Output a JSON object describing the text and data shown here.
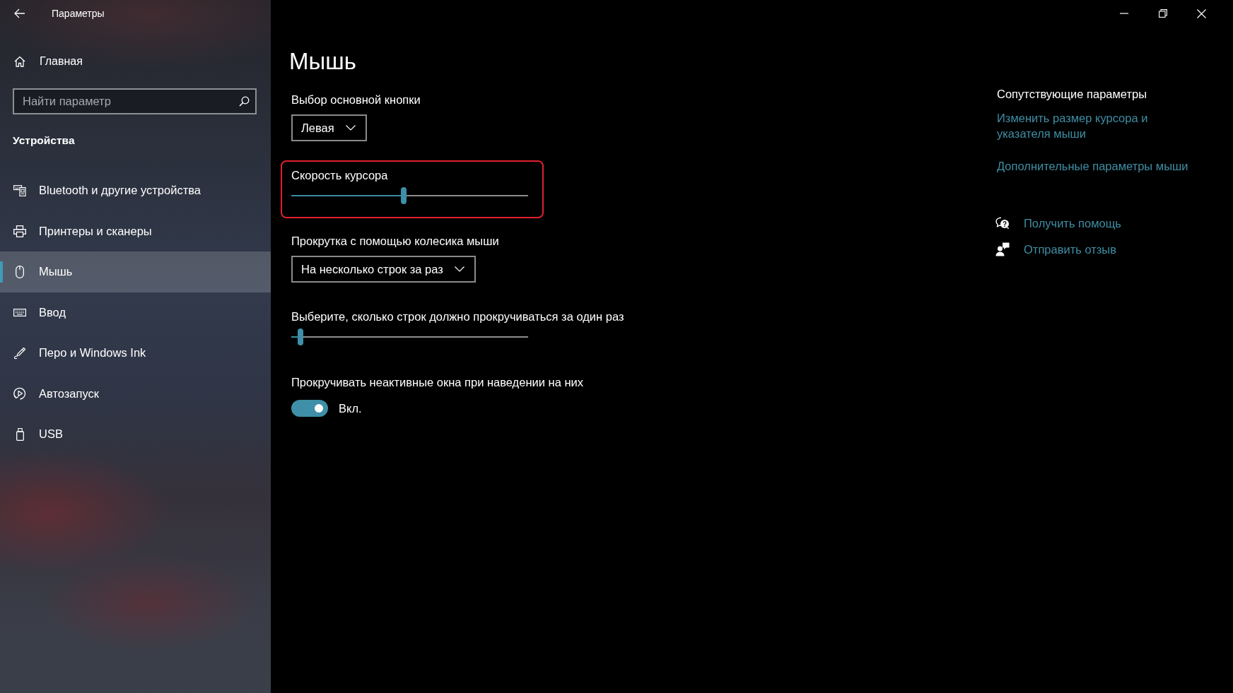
{
  "window": {
    "title": "Параметры"
  },
  "sidebar": {
    "home": "Главная",
    "search": {
      "placeholder": "Найти параметр"
    },
    "section_title": "Устройства",
    "items": [
      {
        "label": "Bluetooth и другие устройства",
        "selected": false
      },
      {
        "label": "Принтеры и сканеры",
        "selected": false
      },
      {
        "label": "Мышь",
        "selected": true
      },
      {
        "label": "Ввод",
        "selected": false
      },
      {
        "label": "Перо и Windows Ink",
        "selected": false
      },
      {
        "label": "Автозапуск",
        "selected": false
      },
      {
        "label": "USB",
        "selected": false
      }
    ]
  },
  "page": {
    "title": "Мышь",
    "settings": [
      {
        "kind": "dropdown",
        "label": "Выбор основной кнопки",
        "value": "Левая",
        "highlighted": false
      },
      {
        "kind": "slider",
        "label": "Скорость курсора",
        "level": 0.475,
        "highlighted": true
      },
      {
        "kind": "dropdown",
        "label": "Прокрутка с помощью колесика мыши",
        "value": "На несколько строк за раз",
        "highlighted": false
      },
      {
        "kind": "slider",
        "label": "Выберите, сколько строк должно прокручиваться за один раз",
        "level": 0.04,
        "highlighted": false
      },
      {
        "kind": "toggle",
        "label": "Прокручивать неактивные окна при наведении на них",
        "on": true,
        "state_label": "Вкл.",
        "highlighted": false
      }
    ]
  },
  "related": {
    "title": "Сопутствующие параметры",
    "links": [
      "Изменить размер курсора и указателя мыши",
      "Дополнительные параметры мыши"
    ]
  },
  "support": [
    "Получить помощь",
    "Отправить отзыв"
  ]
}
